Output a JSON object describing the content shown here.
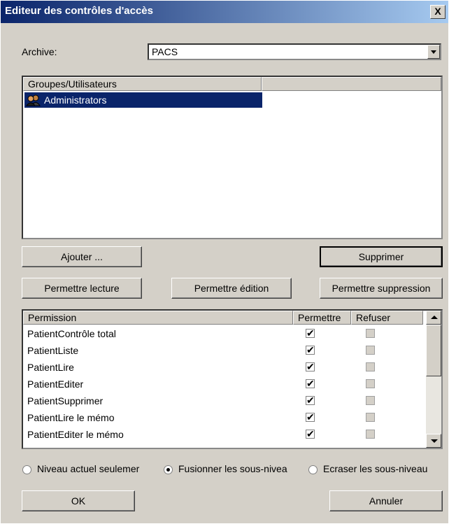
{
  "window": {
    "title": "Editeur des contrôles d'accès",
    "close_label": "X"
  },
  "archive": {
    "label": "Archive:",
    "value": "PACS"
  },
  "users_list": {
    "columns": [
      "Groupes/Utilisateurs",
      ""
    ],
    "items": [
      {
        "label": "Administrators",
        "icon": "users-group-icon",
        "selected": true
      }
    ]
  },
  "user_buttons": {
    "add": "Ajouter ...",
    "remove": "Supprimer"
  },
  "permission_buttons": {
    "read": "Permettre lecture",
    "edit": "Permettre édition",
    "delete": "Permettre suppression"
  },
  "permissions_table": {
    "columns": [
      "Permission",
      "Permettre",
      "Refuser"
    ],
    "rows": [
      {
        "name": "PatientContrôle total",
        "allow": true,
        "deny": false
      },
      {
        "name": "PatientListe",
        "allow": true,
        "deny": false
      },
      {
        "name": "PatientLire",
        "allow": true,
        "deny": false
      },
      {
        "name": "PatientEditer",
        "allow": true,
        "deny": false
      },
      {
        "name": "PatientSupprimer",
        "allow": true,
        "deny": false
      },
      {
        "name": "PatientLire le mémo",
        "allow": true,
        "deny": false
      },
      {
        "name": "PatientEditer le mémo",
        "allow": true,
        "deny": false
      }
    ]
  },
  "options": {
    "current_level": "Niveau actuel seulemer",
    "merge": "Fusionner les sous-nivea",
    "overwrite": "Ecraser les sous-niveau",
    "selected": "merge"
  },
  "dialog_buttons": {
    "ok": "OK",
    "cancel": "Annuler"
  },
  "colors": {
    "face": "#d4d0c8",
    "selection": "#0a246a",
    "title_start": "#0a246a",
    "title_end": "#a6caf0"
  }
}
